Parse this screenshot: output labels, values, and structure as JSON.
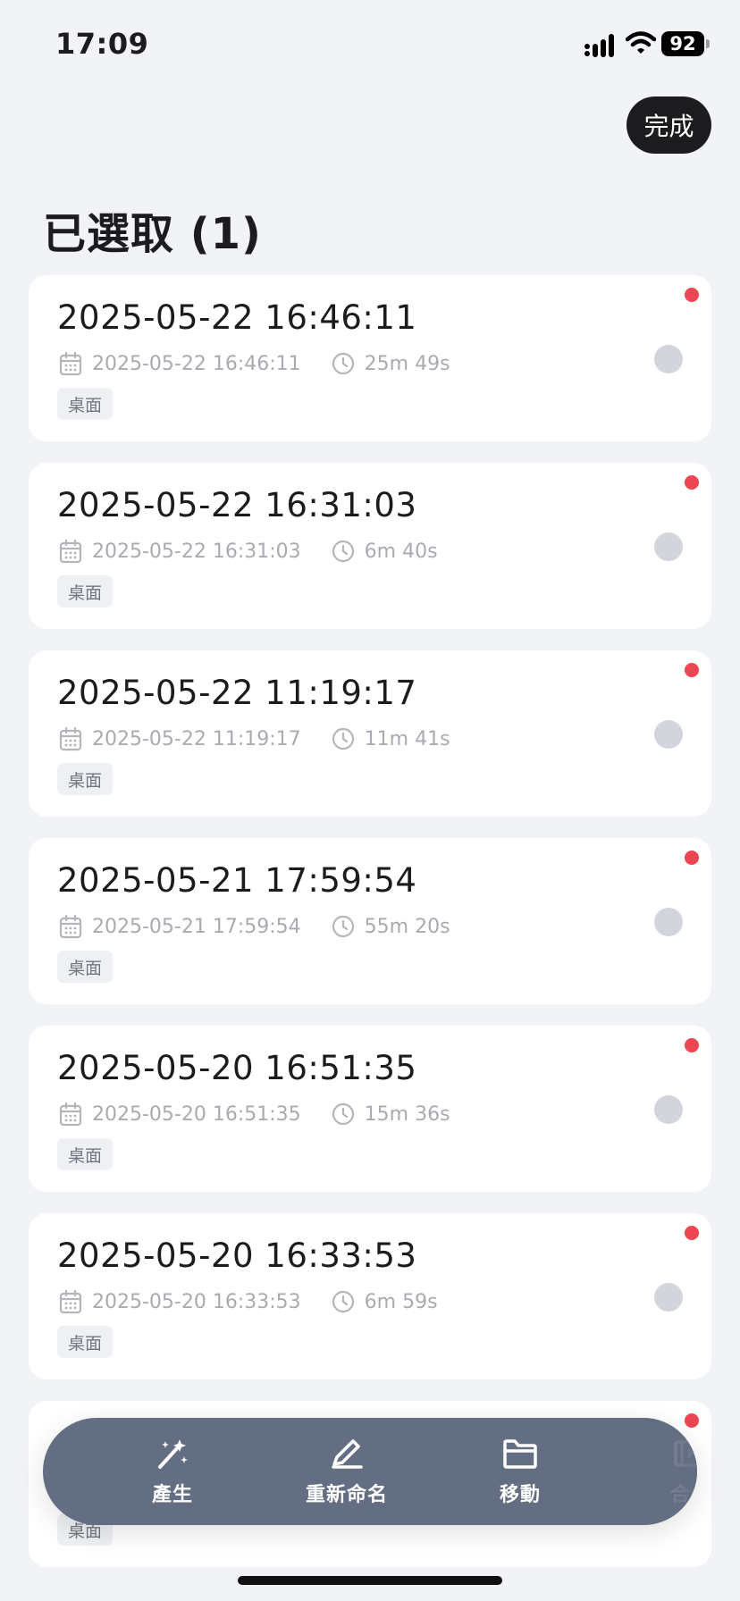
{
  "status_bar": {
    "time": "17:09",
    "battery": "92"
  },
  "header": {
    "done_label": "完成",
    "title": "已選取 (1)"
  },
  "records": [
    {
      "title": "2025-05-22 16:46:11",
      "date": "2025-05-22 16:46:11",
      "duration": "25m 49s",
      "tag": "桌面"
    },
    {
      "title": "2025-05-22 16:31:03",
      "date": "2025-05-22 16:31:03",
      "duration": "6m 40s",
      "tag": "桌面"
    },
    {
      "title": "2025-05-22 11:19:17",
      "date": "2025-05-22 11:19:17",
      "duration": "11m 41s",
      "tag": "桌面"
    },
    {
      "title": "2025-05-21 17:59:54",
      "date": "2025-05-21 17:59:54",
      "duration": "55m 20s",
      "tag": "桌面"
    },
    {
      "title": "2025-05-20 16:51:35",
      "date": "2025-05-20 16:51:35",
      "duration": "15m 36s",
      "tag": "桌面"
    },
    {
      "title": "2025-05-20 16:33:53",
      "date": "2025-05-20 16:33:53",
      "duration": "6m 59s",
      "tag": "桌面"
    },
    {
      "tag": "桌面"
    }
  ],
  "actions": [
    {
      "label": "產生",
      "icon": "magic-wand-icon"
    },
    {
      "label": "重新命名",
      "icon": "pen-icon"
    },
    {
      "label": "移動",
      "icon": "folder-icon"
    },
    {
      "label": "合併",
      "icon": "merge-video-icon"
    }
  ],
  "colors": {
    "unread_dot": "#ec4652",
    "action_bar": "#636e82",
    "done_button": "#1c1c1e"
  }
}
